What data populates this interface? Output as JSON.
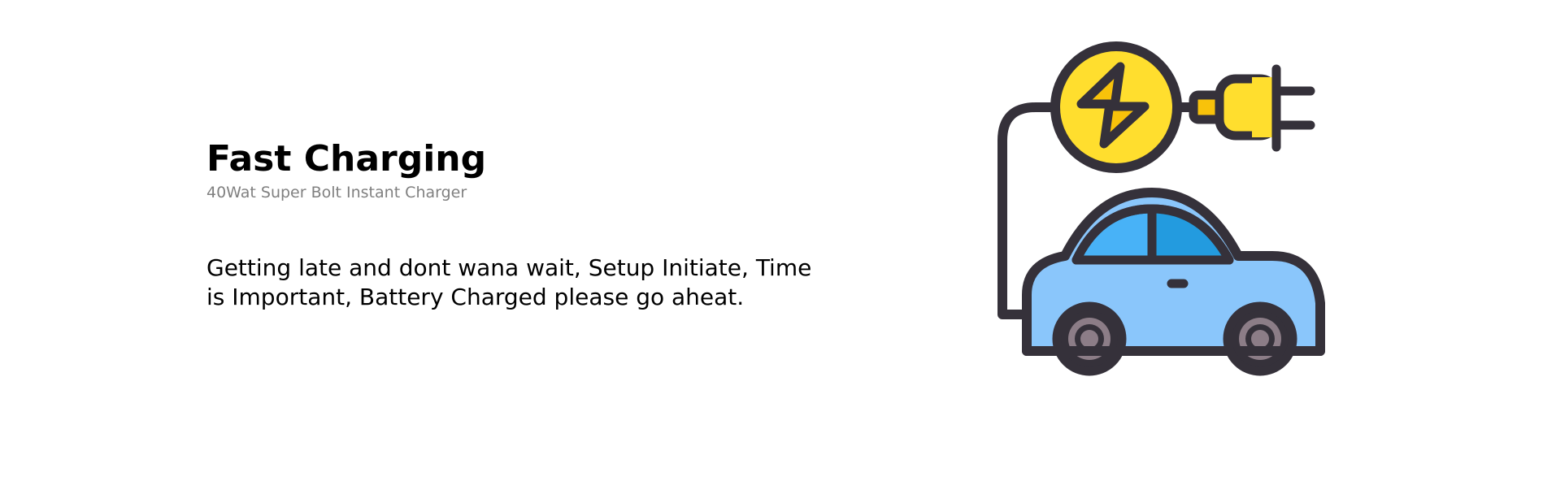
{
  "feature": {
    "title": "Fast Charging",
    "subtitle": "40Wat Super Bolt Instant Charger",
    "description": "Getting late and dont wana wait, Setup Initiate, Time is Important, Battery Charged please go aheat."
  },
  "illustration": {
    "icon": "ev-charging-car-icon",
    "parts": [
      "charging-bolt-icon",
      "plug-icon",
      "cable",
      "car-icon"
    ]
  },
  "colors": {
    "text": "#000000",
    "subtitle": "#808080",
    "outline": "#35313a",
    "bolt_circle": "#ffde2e",
    "bolt": "#f8c20a",
    "plug": "#ffde2e",
    "car_body": "#8ac6fb",
    "car_window_left": "#48b2f7",
    "car_window_right": "#239bdf",
    "wheel_rim": "#8c7d87"
  }
}
